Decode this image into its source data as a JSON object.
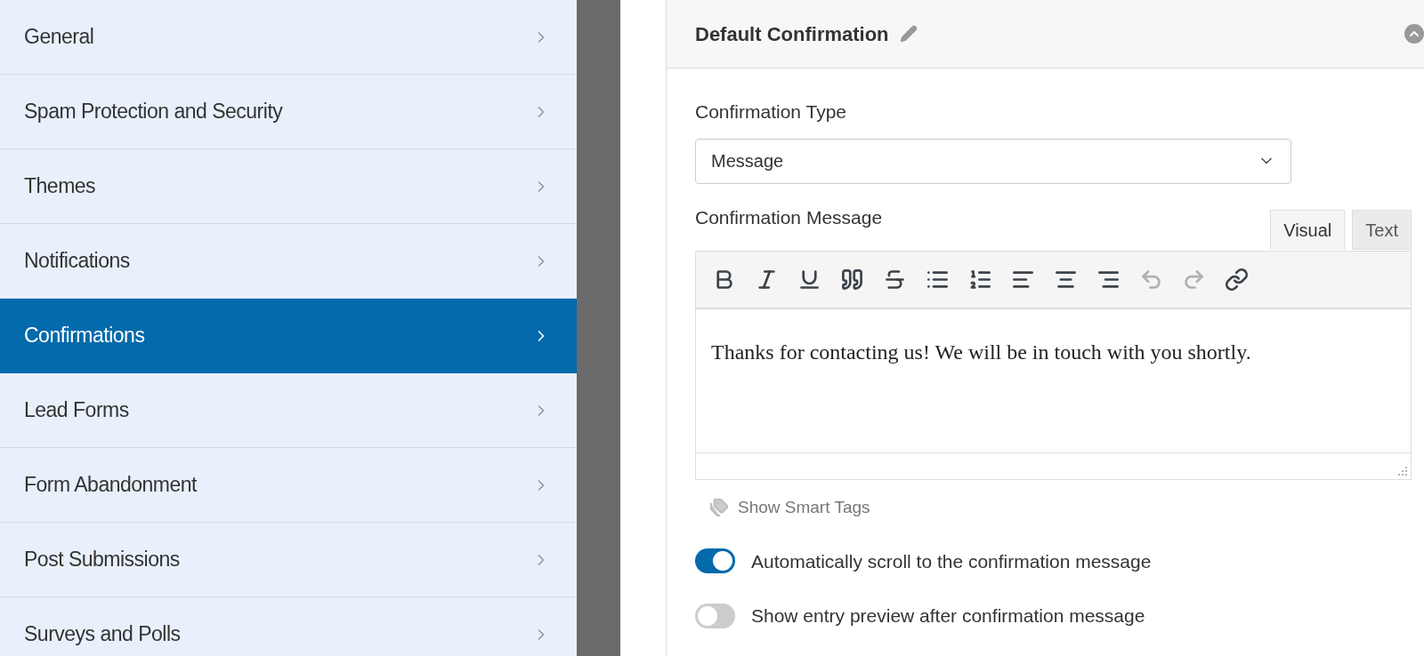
{
  "sidebar": {
    "items": [
      {
        "label": "General",
        "selected": false
      },
      {
        "label": "Spam Protection and Security",
        "selected": false
      },
      {
        "label": "Themes",
        "selected": false
      },
      {
        "label": "Notifications",
        "selected": false
      },
      {
        "label": "Confirmations",
        "selected": true
      },
      {
        "label": "Lead Forms",
        "selected": false
      },
      {
        "label": "Form Abandonment",
        "selected": false
      },
      {
        "label": "Post Submissions",
        "selected": false
      },
      {
        "label": "Surveys and Polls",
        "selected": false
      }
    ]
  },
  "panel": {
    "title": "Default Confirmation",
    "type_label": "Confirmation Type",
    "type_value": "Message",
    "message_label": "Confirmation Message",
    "editor_tabs": [
      {
        "label": "Visual",
        "selected": true
      },
      {
        "label": "Text",
        "selected": false
      }
    ],
    "toolbar": [
      {
        "kind": "bold",
        "disabled": false
      },
      {
        "kind": "italic",
        "disabled": false
      },
      {
        "kind": "underline",
        "disabled": false
      },
      {
        "kind": "quote",
        "disabled": false
      },
      {
        "kind": "strike",
        "disabled": false
      },
      {
        "kind": "bullets",
        "disabled": false
      },
      {
        "kind": "numbers",
        "disabled": false
      },
      {
        "kind": "left",
        "disabled": false
      },
      {
        "kind": "center",
        "disabled": false
      },
      {
        "kind": "right",
        "disabled": false
      },
      {
        "kind": "undo",
        "disabled": true
      },
      {
        "kind": "redo",
        "disabled": true
      },
      {
        "kind": "link",
        "disabled": false
      }
    ],
    "message": "Thanks for contacting us! We will be in touch with you shortly.",
    "smart_tags": "Show Smart Tags",
    "toggles": [
      {
        "label": "Automatically scroll to the confirmation message",
        "on": true
      },
      {
        "label": "Show entry preview after confirmation message",
        "on": false
      }
    ]
  }
}
